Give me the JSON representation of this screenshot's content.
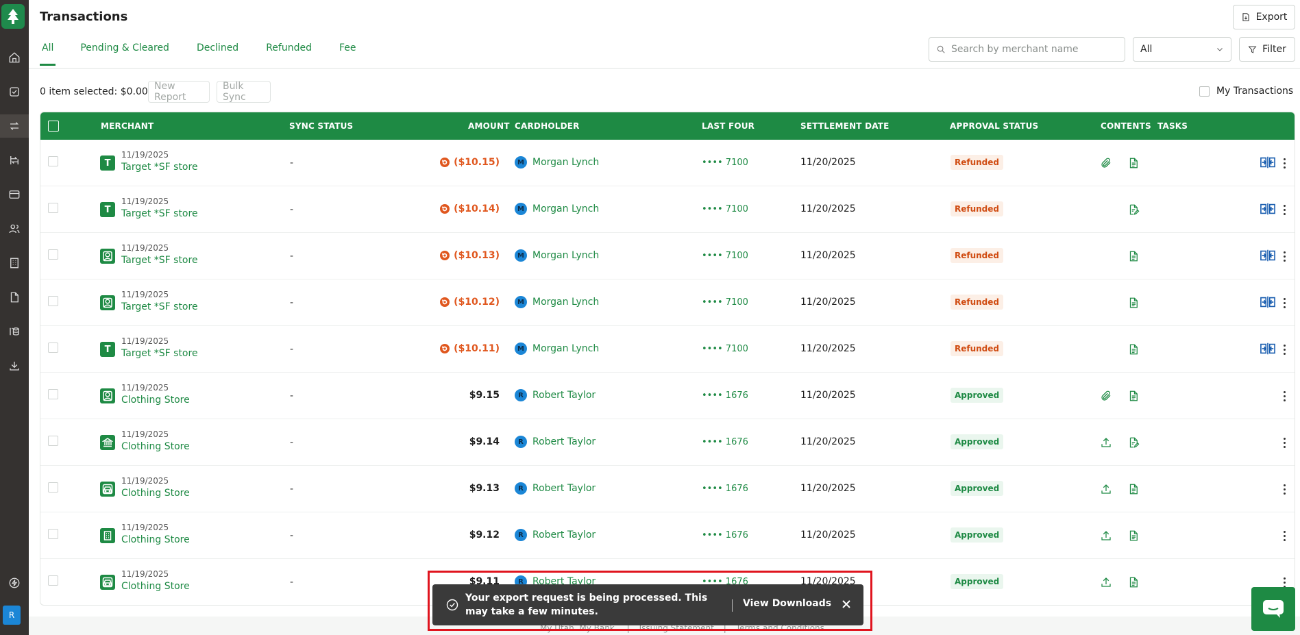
{
  "header": {
    "title": "Transactions",
    "export_label": "Export"
  },
  "tabs": [
    {
      "label": "All",
      "active": true
    },
    {
      "label": "Pending & Cleared"
    },
    {
      "label": "Declined"
    },
    {
      "label": "Refunded"
    },
    {
      "label": "Fee"
    }
  ],
  "search": {
    "placeholder": "Search by merchant name",
    "value": ""
  },
  "type_select": {
    "value": "All"
  },
  "filter_label": "Filter",
  "toolbar": {
    "selected_info": "0 item selected: $0.00",
    "new_report": "New Report",
    "bulk_sync": "Bulk Sync",
    "my_transactions": "My Transactions"
  },
  "columns": [
    "MERCHANT",
    "SYNC STATUS",
    "AMOUNT",
    "CARDHOLDER",
    "LAST FOUR",
    "SETTLEMENT DATE",
    "APPROVAL STATUS",
    "CONTENTS",
    "TASKS"
  ],
  "rows": [
    {
      "date": "11/19/2025",
      "merchant": "Target *SF store",
      "icon": "letter-t",
      "letter": "T",
      "sync": "-",
      "amount": "($10.15)",
      "refund": true,
      "holder_initial": "M",
      "holder": "Morgan Lynch",
      "last4": "•••• 7100",
      "settlement": "11/20/2025",
      "status": "Refunded",
      "contents": [
        "attachment-icon",
        "receipt-icon"
      ],
      "split": true
    },
    {
      "date": "11/19/2025",
      "merchant": "Target *SF store",
      "icon": "letter-t",
      "letter": "T",
      "sync": "-",
      "amount": "($10.14)",
      "refund": true,
      "holder_initial": "M",
      "holder": "Morgan Lynch",
      "last4": "•••• 7100",
      "settlement": "11/20/2025",
      "status": "Refunded",
      "contents": [
        "receipt-edit-icon"
      ],
      "split": true
    },
    {
      "date": "11/19/2025",
      "merchant": "Target *SF store",
      "icon": "person",
      "letter": "",
      "sync": "-",
      "amount": "($10.13)",
      "refund": true,
      "holder_initial": "M",
      "holder": "Morgan Lynch",
      "last4": "•••• 7100",
      "settlement": "11/20/2025",
      "status": "Refunded",
      "contents": [
        "receipt-icon"
      ],
      "split": true
    },
    {
      "date": "11/19/2025",
      "merchant": "Target *SF store",
      "icon": "person",
      "letter": "",
      "sync": "-",
      "amount": "($10.12)",
      "refund": true,
      "holder_initial": "M",
      "holder": "Morgan Lynch",
      "last4": "•••• 7100",
      "settlement": "11/20/2025",
      "status": "Refunded",
      "contents": [
        "receipt-icon"
      ],
      "split": true
    },
    {
      "date": "11/19/2025",
      "merchant": "Target *SF store",
      "icon": "letter-t",
      "letter": "T",
      "sync": "-",
      "amount": "($10.11)",
      "refund": true,
      "holder_initial": "M",
      "holder": "Morgan Lynch",
      "last4": "•••• 7100",
      "settlement": "11/20/2025",
      "status": "Refunded",
      "contents": [
        "receipt-icon"
      ],
      "split": true
    },
    {
      "date": "11/19/2025",
      "merchant": "Clothing Store",
      "icon": "person",
      "letter": "",
      "sync": "-",
      "amount": "$9.15",
      "refund": false,
      "holder_initial": "R",
      "holder": "Robert Taylor",
      "last4": "•••• 1676",
      "settlement": "11/20/2025",
      "status": "Approved",
      "contents": [
        "attachment-icon",
        "receipt-icon"
      ],
      "split": false
    },
    {
      "date": "11/19/2025",
      "merchant": "Clothing Store",
      "icon": "bank",
      "letter": "",
      "sync": "-",
      "amount": "$9.14",
      "refund": false,
      "holder_initial": "R",
      "holder": "Robert Taylor",
      "last4": "•••• 1676",
      "settlement": "11/20/2025",
      "status": "Approved",
      "contents": [
        "upload-icon",
        "receipt-edit-icon"
      ],
      "split": false
    },
    {
      "date": "11/19/2025",
      "merchant": "Clothing Store",
      "icon": "car",
      "letter": "",
      "sync": "-",
      "amount": "$9.13",
      "refund": false,
      "holder_initial": "R",
      "holder": "Robert Taylor",
      "last4": "•••• 1676",
      "settlement": "11/20/2025",
      "status": "Approved",
      "contents": [
        "upload-icon",
        "receipt-icon"
      ],
      "split": false
    },
    {
      "date": "11/19/2025",
      "merchant": "Clothing Store",
      "icon": "building",
      "letter": "",
      "sync": "-",
      "amount": "$9.12",
      "refund": false,
      "holder_initial": "R",
      "holder": "Robert Taylor",
      "last4": "•••• 1676",
      "settlement": "11/20/2025",
      "status": "Approved",
      "contents": [
        "upload-icon",
        "receipt-icon"
      ],
      "split": false
    },
    {
      "date": "11/19/2025",
      "merchant": "Clothing Store",
      "icon": "car",
      "letter": "",
      "sync": "-",
      "amount": "$9.11",
      "refund": false,
      "holder_initial": "R",
      "holder": "Robert Taylor",
      "last4": "•••• 1676",
      "settlement": "11/20/2025",
      "status": "Approved",
      "contents": [
        "upload-icon",
        "receipt-icon"
      ],
      "split": false
    }
  ],
  "footer_links": [
    "My Utah. My Bank.",
    "Issuing Statement",
    "Terms and Conditions"
  ],
  "toast": {
    "message": "Your export request is being processed. This may take a few minutes.",
    "action": "View Downloads"
  },
  "user_avatar": "R",
  "colors": {
    "brand_green": "#1e8a44",
    "refund_orange": "#e0571e",
    "rail": "#353230",
    "highlight_red": "#e0141e"
  }
}
